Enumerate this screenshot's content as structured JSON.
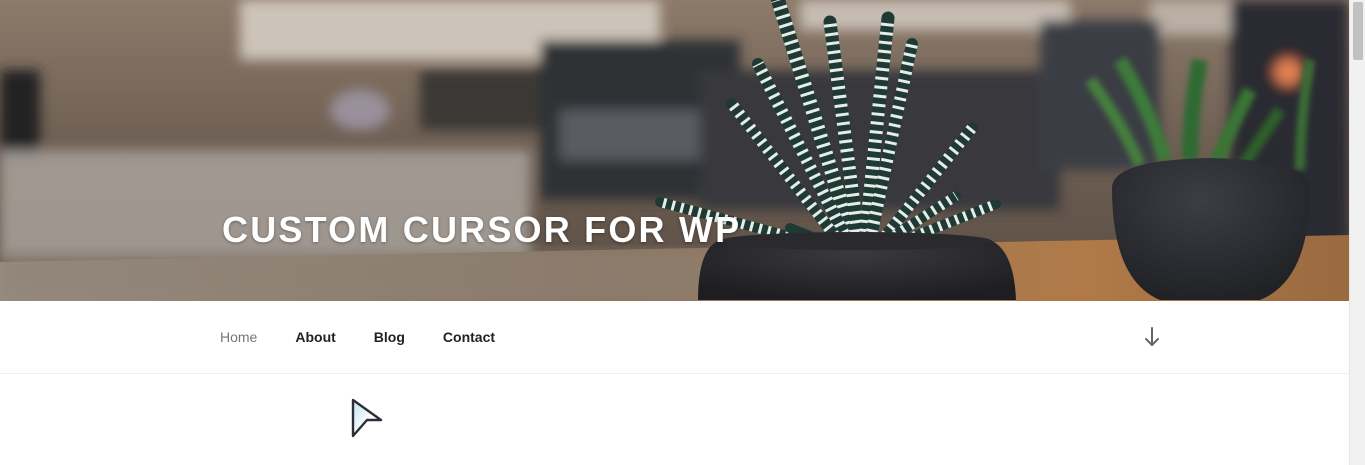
{
  "header": {
    "site_title": "CUSTOM CURSOR FOR WP"
  },
  "nav": {
    "items": [
      {
        "label": "Home",
        "current": true
      },
      {
        "label": "About",
        "current": false
      },
      {
        "label": "Blog",
        "current": false
      },
      {
        "label": "Contact",
        "current": false
      }
    ],
    "scroll_icon": "arrow-down-icon"
  },
  "cursor": {
    "icon": "custom-arrow-cursor-icon"
  },
  "colors": {
    "title": "#ffffff",
    "nav_text": "#222222",
    "nav_current": "#767676",
    "background": "#ffffff"
  }
}
